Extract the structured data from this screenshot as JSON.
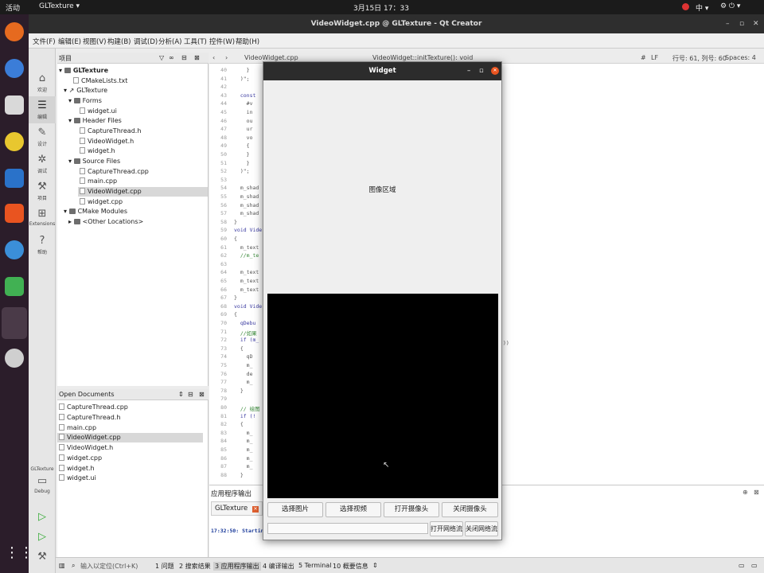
{
  "topbar": {
    "activities": "活动",
    "app_menu": "GLTexture ▾",
    "clock": "3月15日 17：33",
    "ime": "中 ▾",
    "tray": "⚙ ⏻ ▾"
  },
  "window": {
    "title": "VideoWidget.cpp @ GLTexture - Qt Creator"
  },
  "menubar": [
    "文件(F)",
    "编辑(E)",
    "视图(V)",
    "构建(B)",
    "调试(D)",
    "分析(A)",
    "工具(T)",
    "控件(W)",
    "帮助(H)"
  ],
  "modes": [
    "欢迎",
    "编辑",
    "设计",
    "调试",
    "项目",
    "Extensions",
    "帮助"
  ],
  "kit": {
    "project": "GLTexture",
    "mode": "Debug"
  },
  "project_pane": {
    "title": "项目"
  },
  "tree": [
    {
      "label": "GLTexture",
      "level": 0,
      "kind": "root",
      "arrow": "▾"
    },
    {
      "label": "CMakeLists.txt",
      "level": 1,
      "kind": "file"
    },
    {
      "label": "GLTexture",
      "level": 1,
      "kind": "target",
      "arrow": "▾"
    },
    {
      "label": "Forms",
      "level": 2,
      "kind": "folder",
      "arrow": "▾"
    },
    {
      "label": "widget.ui",
      "level": 3,
      "kind": "file"
    },
    {
      "label": "Header Files",
      "level": 2,
      "kind": "folder",
      "arrow": "▾"
    },
    {
      "label": "CaptureThread.h",
      "level": 3,
      "kind": "file"
    },
    {
      "label": "VideoWidget.h",
      "level": 3,
      "kind": "file"
    },
    {
      "label": "widget.h",
      "level": 3,
      "kind": "file"
    },
    {
      "label": "Source Files",
      "level": 2,
      "kind": "folder",
      "arrow": "▾"
    },
    {
      "label": "CaptureThread.cpp",
      "level": 3,
      "kind": "file"
    },
    {
      "label": "main.cpp",
      "level": 3,
      "kind": "file"
    },
    {
      "label": "VideoWidget.cpp",
      "level": 3,
      "kind": "file",
      "selected": true
    },
    {
      "label": "widget.cpp",
      "level": 3,
      "kind": "file"
    },
    {
      "label": "CMake Modules",
      "level": 1,
      "kind": "folder",
      "arrow": "▾"
    },
    {
      "label": "<Other Locations>",
      "level": 2,
      "kind": "folder",
      "arrow": "▸"
    }
  ],
  "open_docs": {
    "title": "Open Documents",
    "items": [
      "CaptureThread.cpp",
      "CaptureThread.h",
      "main.cpp",
      "VideoWidget.cpp",
      "VideoWidget.h",
      "widget.cpp",
      "widget.h",
      "widget.ui"
    ],
    "selected": 3
  },
  "editor": {
    "file_tab": "VideoWidget.cpp",
    "symbol": "VideoWidget::initTexture(): void",
    "encoding": "#",
    "line_ending": "LF",
    "position": "行号: 61, 列号: 60",
    "spaces": "Spaces: 4"
  },
  "line_numbers": [
    "40",
    "41",
    "42",
    "43",
    "44",
    "45",
    "46",
    "47",
    "48",
    "49",
    "50",
    "51",
    "52",
    "53",
    "54",
    "55",
    "56",
    "57",
    "58",
    "59",
    "60",
    "61",
    "62",
    "63",
    "64",
    "65",
    "66",
    "67",
    "68",
    "69",
    "70",
    "71",
    "72",
    "73",
    "74",
    "75",
    "76",
    "77",
    "78",
    "79",
    "80",
    "81",
    "82",
    "83",
    "84",
    "85",
    "86",
    "87",
    "88"
  ],
  "code": [
    "    }",
    "  )\";",
    "",
    "  const",
    "    #v",
    "    in",
    "    ou",
    "    ur",
    "    vo",
    "    {",
    "    }",
    "    }",
    "  )\";",
    "",
    "  m_shad",
    "  m_shad",
    "  m_shad",
    "  m_shad",
    "}",
    "void Vide",
    "{",
    "  m_text",
    "  //m_te",
    "",
    "  m_text",
    "  m_text",
    "  m_text",
    "}",
    "void Vide",
    "{",
    "  qDebu",
    "  //如果",
    "  if (m_",
    "  {",
    "    qD",
    "    m_",
    "    de",
    "    m_",
    "  }",
    "",
    "  // 绘图",
    "  if (!",
    "  {",
    "    m_",
    "    m_",
    "    m_",
    "    m_",
    "    m_",
    "  }"
  ],
  "code_tail": "))",
  "output": {
    "title": "应用程序输出",
    "tab": "GLTexture",
    "log": "17:32:50: Starting"
  },
  "statusbar": {
    "locate": "输入以定位(Ctrl+K)",
    "items": [
      "1 问题",
      "2 搜索结果",
      "3 应用程序输出",
      "4 编译输出",
      "5 Terminal",
      "10 概要信息"
    ],
    "more": "⇕"
  },
  "dialog": {
    "title": "Widget",
    "image_area": "图像区域",
    "buttons": [
      "选择图片",
      "选择视频",
      "打开摄像头",
      "关闭摄像头"
    ],
    "net_url": "",
    "net_open": "打开网络流",
    "net_close": "关闭网络流"
  }
}
